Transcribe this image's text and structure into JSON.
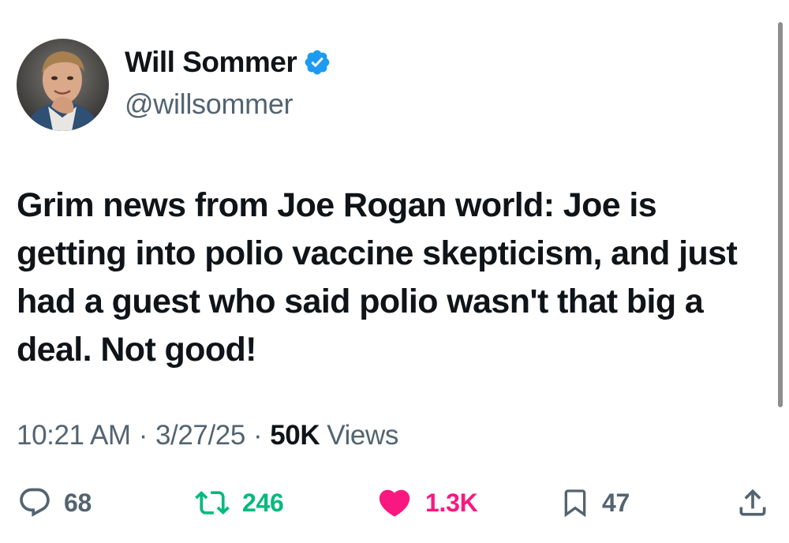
{
  "author": {
    "name": "Will Sommer",
    "handle": "@willsommer",
    "avatar_icon": "profile-photo",
    "verified_icon": "verified-badge-icon",
    "verified_color": "#1d9bf0"
  },
  "tweet": {
    "text": "Grim news from Joe Rogan world: Joe is getting into polio vaccine skepticism, and just had a guest who said polio wasn't that big a deal. Not good!"
  },
  "meta": {
    "time": "10:21 AM",
    "separator": "·",
    "date": "3/27/25",
    "views_count": "50K",
    "views_label": "Views"
  },
  "actions": {
    "reply": {
      "icon": "reply-icon",
      "count": "68"
    },
    "retweet": {
      "icon": "retweet-icon",
      "count": "246",
      "color": "#00ba7c"
    },
    "like": {
      "icon": "heart-filled-icon",
      "count": "1.3K",
      "color": "#f91880"
    },
    "bookmark": {
      "icon": "bookmark-icon",
      "count": "47"
    },
    "share": {
      "icon": "share-icon"
    }
  },
  "colors": {
    "text": "#0f1419",
    "secondary": "#536471",
    "background": "#ffffff"
  }
}
